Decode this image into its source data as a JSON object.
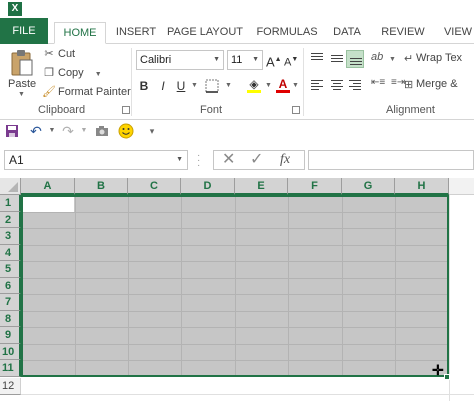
{
  "tabs": {
    "file": "FILE",
    "home": "HOME",
    "insert": "INSERT",
    "page_layout": "PAGE LAYOUT",
    "formulas": "FORMULAS",
    "data": "DATA",
    "review": "REVIEW",
    "view": "VIEW"
  },
  "clipboard": {
    "paste": "Paste",
    "cut": "Cut",
    "copy": "Copy",
    "format_painter": "Format Painter",
    "group_label": "Clipboard"
  },
  "font": {
    "name": "Calibri",
    "size": "11",
    "group_label": "Font",
    "bold": "B",
    "italic": "I",
    "underline": "U"
  },
  "alignment": {
    "wrap_text": "Wrap Tex",
    "merge": "Merge &",
    "group_label": "Alignment"
  },
  "formula_bar": {
    "name_box": "A1",
    "fx": "fx"
  },
  "grid": {
    "columns": [
      "A",
      "B",
      "C",
      "D",
      "E",
      "F",
      "G",
      "H"
    ],
    "rows": [
      "1",
      "2",
      "3",
      "4",
      "5",
      "6",
      "7",
      "8",
      "9",
      "10",
      "11",
      "12"
    ]
  },
  "colors": {
    "accent": "#217346",
    "selection_fill": "#c6c6c6"
  }
}
